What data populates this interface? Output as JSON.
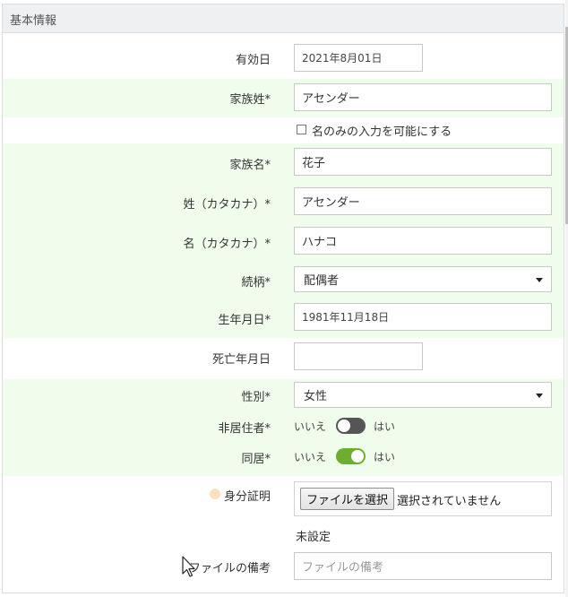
{
  "section_title": "基本情報",
  "fields": {
    "effective_date": {
      "label": "有効日",
      "value": "2021年8月01日"
    },
    "family_last_name": {
      "label": "家族姓*",
      "value": "アセンダー"
    },
    "first_name_only_checkbox": {
      "label": "名のみの入力を可能にする",
      "checked": false
    },
    "family_first_name": {
      "label": "家族名*",
      "value": "花子"
    },
    "last_name_kana": {
      "label": "姓（カタカナ）*",
      "value": "アセンダー"
    },
    "first_name_kana": {
      "label": "名（カタカナ）*",
      "value": "ハナコ"
    },
    "relationship": {
      "label": "続柄*",
      "value": "配偶者"
    },
    "birth_date": {
      "label": "生年月日*",
      "value": "1981年11月18日"
    },
    "death_date": {
      "label": "死亡年月日",
      "value": ""
    },
    "gender": {
      "label": "性別*",
      "value": "女性"
    },
    "non_resident": {
      "label": "非居住者*",
      "off_label": "いいえ",
      "on_label": "はい",
      "on": false
    },
    "cohabiting": {
      "label": "同居*",
      "off_label": "いいえ",
      "on_label": "はい",
      "on": true
    },
    "id_document": {
      "label": "身分証明",
      "button_label": "ファイルを選択",
      "status": "選択されていません",
      "current": "未設定"
    },
    "file_note": {
      "label": "ファイルの備考",
      "placeholder": "ファイルの備考"
    }
  },
  "colors": {
    "band": "#f0fcec",
    "toggle_on": "#6cae2d",
    "toggle_off": "#555555",
    "header_bg": "#eef0f2"
  },
  "icons": {
    "select_arrow": "chevron-down-icon",
    "info": "info-dot-icon",
    "cursor": "mouse-pointer-icon"
  }
}
